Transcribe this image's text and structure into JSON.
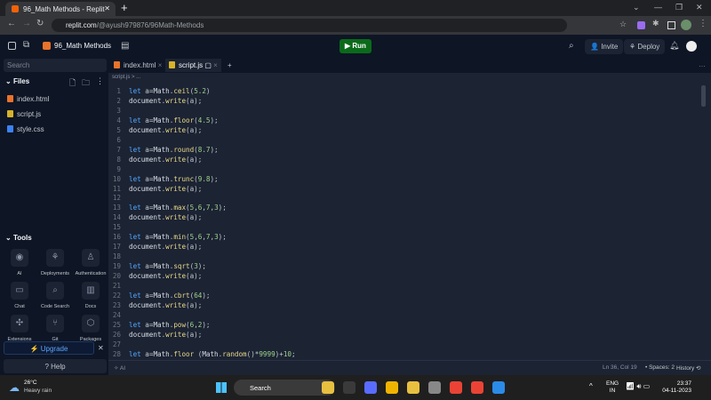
{
  "browser": {
    "tab_title": "96_Math Methods - Replit",
    "url_host": "replit.com",
    "url_path": "/@ayush979876/96Math-Methods"
  },
  "header": {
    "project": "96_Math Methods",
    "run_label": "Run",
    "invite_label": "Invite",
    "deploy_label": "Deploy"
  },
  "sidebar": {
    "search_placeholder": "Search",
    "files_title": "Files",
    "files": [
      {
        "name": "index.html",
        "color": "#e8732a"
      },
      {
        "name": "script.js",
        "color": "#d6b32a"
      },
      {
        "name": "style.css",
        "color": "#3b82f6"
      }
    ],
    "tools_title": "Tools",
    "tools": [
      {
        "label": "AI",
        "icon": "ai-icon"
      },
      {
        "label": "Deployments",
        "icon": "deploy-icon"
      },
      {
        "label": "Authentication",
        "icon": "user-icon"
      },
      {
        "label": "Chat",
        "icon": "chat-icon"
      },
      {
        "label": "Code Search",
        "icon": "search-icon"
      },
      {
        "label": "Docs",
        "icon": "book-icon"
      },
      {
        "label": "Extensions",
        "icon": "puzzle-icon"
      },
      {
        "label": "Git",
        "icon": "git-icon"
      },
      {
        "label": "Packages",
        "icon": "package-icon"
      }
    ],
    "upgrade_label": "Upgrade",
    "help_label": "Help"
  },
  "editor": {
    "tabs": [
      "index.html",
      "script.js"
    ],
    "breadcrumb": "script.js  >  ...",
    "lines": [
      "let a=Math.ceil(5.2)",
      "document.write(a);",
      "",
      "let a=Math.floor(4.5);",
      "document.write(a);",
      "",
      "let a=Math.round(8.7);",
      "document.write(a);",
      "",
      "let a=Math.trunc(9.8);",
      "document.write(a);",
      "",
      "let a=Math.max(5,6,7,3);",
      "document.write(a);",
      "",
      "let a=Math.min(5,6,7,3);",
      "document.write(a);",
      "",
      "let a=Math.sqrt(3);",
      "document.write(a);",
      "",
      "let a=Math.cbrt(64);",
      "document.write(a);",
      "",
      "let a=Math.pow(6,2);",
      "document.write(a);",
      "",
      "let a=Math.floor (Math.random()*9999)+10;"
    ]
  },
  "status": {
    "ai": "AI",
    "position": "Ln 36, Col 19",
    "spaces": "Spaces: 2",
    "history": "History"
  },
  "taskbar": {
    "temp": "26°C",
    "weather": "Heavy rain",
    "search": "Search",
    "lang1": "ENG",
    "lang2": "IN",
    "time": "23:37",
    "date": "04-11-2023"
  }
}
